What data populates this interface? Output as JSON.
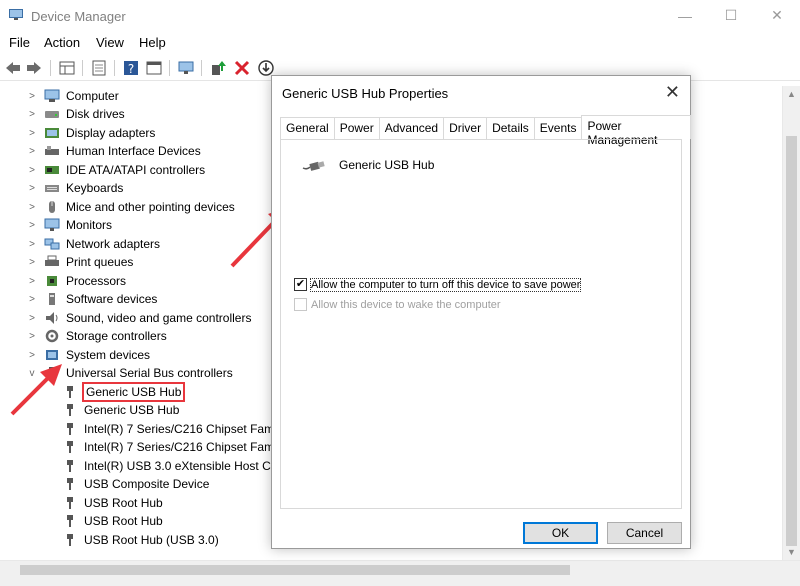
{
  "window": {
    "title": "Device Manager",
    "controls": {
      "minimize": "—",
      "maximize": "☐",
      "close": "✕"
    }
  },
  "menu": [
    "File",
    "Action",
    "View",
    "Help"
  ],
  "toolbar_icons": [
    "back-icon",
    "forward-icon",
    "properties-grid-icon",
    "sheet-icon",
    "help-icon",
    "panel-icon",
    "monitor-icon",
    "add-driver-icon",
    "uninstall-icon",
    "update-driver-icon"
  ],
  "tree": {
    "categories": [
      {
        "label": "Computer",
        "icon": "computer-icon",
        "expanded": false
      },
      {
        "label": "Disk drives",
        "icon": "disk-icon",
        "expanded": false
      },
      {
        "label": "Display adapters",
        "icon": "display-icon",
        "expanded": false
      },
      {
        "label": "Human Interface Devices",
        "icon": "hid-icon",
        "expanded": false
      },
      {
        "label": "IDE ATA/ATAPI controllers",
        "icon": "ide-icon",
        "expanded": false
      },
      {
        "label": "Keyboards",
        "icon": "keyboard-icon",
        "expanded": false
      },
      {
        "label": "Mice and other pointing devices",
        "icon": "mouse-icon",
        "expanded": false
      },
      {
        "label": "Monitors",
        "icon": "monitor-icon",
        "expanded": false
      },
      {
        "label": "Network adapters",
        "icon": "network-icon",
        "expanded": false
      },
      {
        "label": "Print queues",
        "icon": "printer-icon",
        "expanded": false
      },
      {
        "label": "Processors",
        "icon": "processor-icon",
        "expanded": false
      },
      {
        "label": "Software devices",
        "icon": "software-icon",
        "expanded": false
      },
      {
        "label": "Sound, video and game controllers",
        "icon": "sound-icon",
        "expanded": false
      },
      {
        "label": "Storage controllers",
        "icon": "storage-icon",
        "expanded": false
      },
      {
        "label": "System devices",
        "icon": "system-icon",
        "expanded": false
      },
      {
        "label": "Universal Serial Bus controllers",
        "icon": "usb-icon",
        "expanded": true
      }
    ],
    "usb_children": [
      "Generic USB Hub",
      "Generic USB Hub",
      "Intel(R) 7 Series/C216 Chipset Fami",
      "Intel(R) 7 Series/C216 Chipset Fami",
      "Intel(R) USB 3.0 eXtensible Host Co",
      "USB Composite Device",
      "USB Root Hub",
      "USB Root Hub",
      "USB Root Hub (USB 3.0)"
    ]
  },
  "dialog": {
    "title": "Generic USB Hub Properties",
    "close": "✕",
    "tabs": [
      "General",
      "Power",
      "Advanced",
      "Driver",
      "Details",
      "Events",
      "Power Management"
    ],
    "active_tab": "Power Management",
    "device_name": "Generic USB Hub",
    "options": [
      {
        "label": "Allow the computer to turn off this device to save power",
        "checked": true,
        "enabled": true
      },
      {
        "label": "Allow this device to wake the computer",
        "checked": false,
        "enabled": false
      }
    ],
    "ok": "OK",
    "cancel": "Cancel"
  },
  "colors": {
    "highlight": "#e8363d",
    "accent": "#0078d7"
  }
}
